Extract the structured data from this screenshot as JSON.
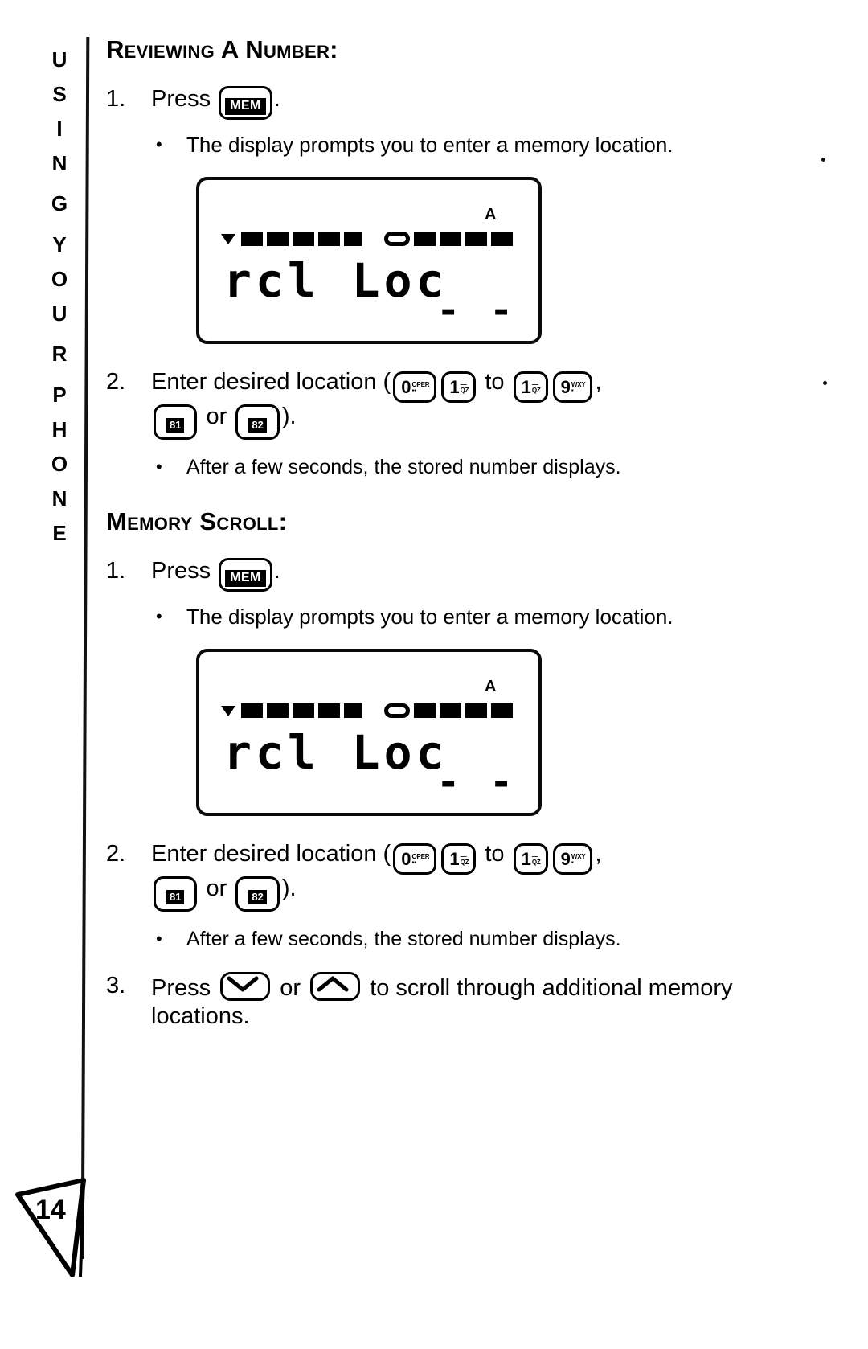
{
  "page": {
    "number": "14",
    "running_head": "USING YOUR PHONE",
    "running_head_chars": [
      "U",
      "S",
      "I",
      "N",
      "G",
      "Y",
      "O",
      "U",
      "R",
      "P",
      "H",
      "O",
      "N",
      "E"
    ]
  },
  "sections": [
    {
      "heading": "Reviewing A Number:",
      "steps": [
        {
          "number": "1.",
          "text_before": "Press",
          "key": "MEM",
          "text_after": ".",
          "bullets": [
            "The display prompts you to enter a memory location."
          ]
        },
        {
          "number": "2.",
          "text_before": "Enter desired location (",
          "text_to": "to",
          "text_or": "or",
          "text_after": ").",
          "bullets": [
            "After a few seconds, the stored number displays."
          ]
        }
      ]
    },
    {
      "heading": "Memory Scroll:",
      "steps": [
        {
          "number": "1.",
          "text_before": "Press",
          "key": "MEM",
          "text_after": ".",
          "bullets": [
            "The display prompts you to enter a memory location."
          ]
        },
        {
          "number": "2.",
          "text_before": "Enter desired location (",
          "text_to": "to",
          "text_or": "or",
          "text_after": ").",
          "bullets": [
            "After a few seconds, the stored number displays."
          ]
        },
        {
          "number": "3.",
          "text_before": "Press",
          "text_or": "or",
          "text_after": "to scroll through additional memory locations."
        }
      ]
    }
  ],
  "keys": {
    "mem": "MEM",
    "digit_0": {
      "digit": "0",
      "sub1": "OPER",
      "sub2": ""
    },
    "digit_1_a": {
      "digit": "1",
      "sub1": "1",
      "sub2": "QZ"
    },
    "digit_1_b": {
      "digit": "1",
      "sub1": "1",
      "sub2": "QZ"
    },
    "digit_9": {
      "digit": "9",
      "sub1": "WXY",
      "sub2": ""
    },
    "mem_81": "81",
    "mem_82": "82",
    "scroll_down": "down-arrow",
    "scroll_up": "up-arrow"
  },
  "lcd": {
    "indicator_label": "A",
    "line1": "rcl Loc",
    "dashes": "- -",
    "segments": [
      "triangle",
      "block",
      "block",
      "block",
      "block",
      "block",
      "gap",
      "hollow",
      "block",
      "block",
      "block",
      "block"
    ]
  }
}
